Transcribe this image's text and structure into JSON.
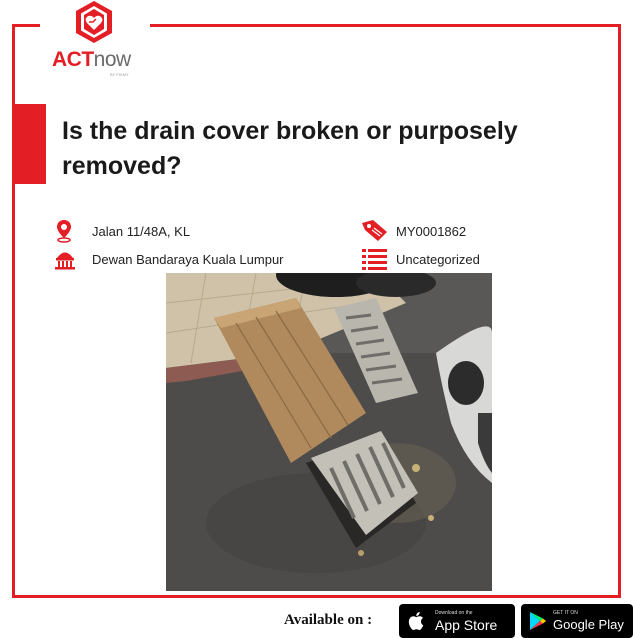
{
  "brand": {
    "act": "ACT",
    "now": "now",
    "tagline": "BY FIXMY"
  },
  "report": {
    "title": "Is the drain cover broken or purposely removed?",
    "location": "Jalan 11/48A, KL",
    "agency": "Dewan Bandaraya Kuala Lumpur",
    "ticket_id": "MY0001862",
    "category": "Uncategorized"
  },
  "footer": {
    "available_label": "Available on :",
    "appstore_small": "Download on the",
    "appstore_big": "App Store",
    "googleplay_small": "GET IT ON",
    "googleplay_big": "Google Play"
  },
  "colors": {
    "accent": "#e31e24"
  }
}
